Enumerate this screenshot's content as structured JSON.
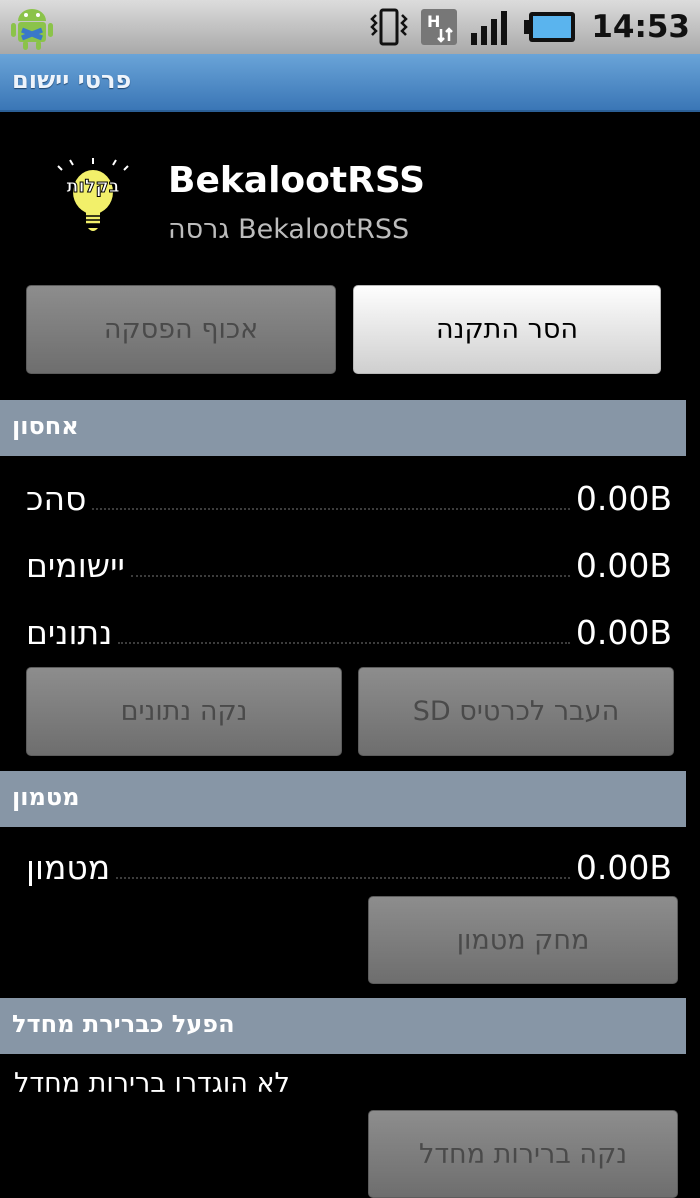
{
  "status_bar": {
    "time": "14:53",
    "icons": [
      "android-debug-icon",
      "vibrate-icon",
      "hsdpa-icon",
      "signal-icon",
      "battery-icon"
    ]
  },
  "title_bar": {
    "title": "פרטי יישום"
  },
  "app": {
    "name": "BekalootRSS",
    "version": "גרסה BekalootRSS",
    "logo_text": "בקלות"
  },
  "buttons": {
    "uninstall": "הסר התקנה",
    "force_stop": "אכוף הפסקה",
    "move_to_sd": "העבר לכרטיס SD",
    "clear_data": "נקה נתונים",
    "clear_cache": "מחק מטמון",
    "clear_defaults": "נקה ברירות מחדל"
  },
  "storage": {
    "header": "אחסון",
    "rows": [
      {
        "label": "סהכ",
        "value": "0.00B"
      },
      {
        "label": "יישומים",
        "value": "0.00B"
      },
      {
        "label": "נתונים",
        "value": "0.00B"
      }
    ]
  },
  "cache": {
    "header": "מטמון",
    "row": {
      "label": "מטמון",
      "value": "0.00B"
    }
  },
  "launch_default": {
    "header": "הפעל כברירת מחדל",
    "note": "לא הוגדרו ברירות מחדל"
  },
  "colors": {
    "title_bar": "#4a86c4",
    "section_header": "#8796a6",
    "background": "#000000"
  }
}
